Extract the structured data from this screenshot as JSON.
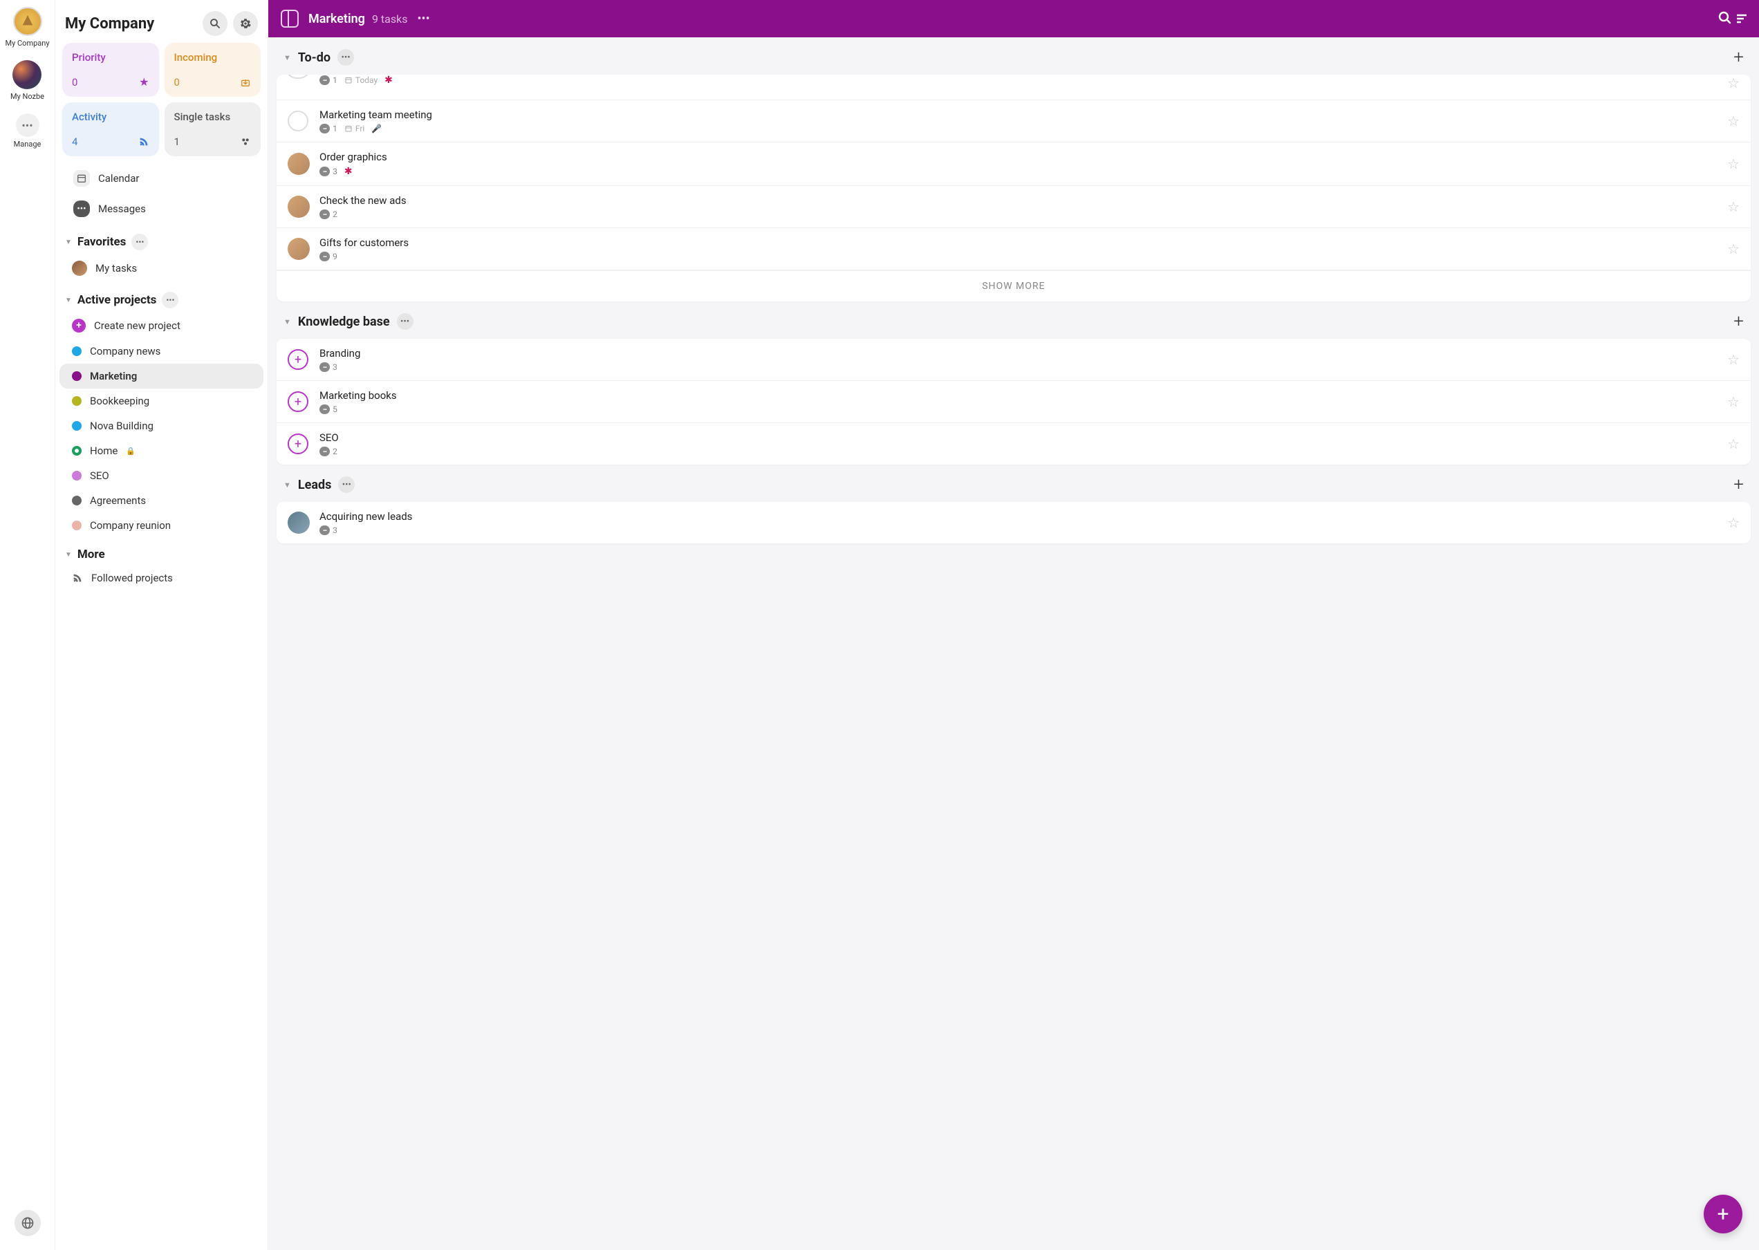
{
  "rail": {
    "company": "My Company",
    "nozbe": "My Nozbe",
    "manage": "Manage"
  },
  "sidebar": {
    "title": "My Company",
    "tiles": {
      "priority": {
        "label": "Priority",
        "count": "0",
        "color": "#a238c4",
        "bg": "#f5ecfa",
        "icon": "★"
      },
      "incoming": {
        "label": "Incoming",
        "count": "0",
        "color": "#d98b1e",
        "bg": "#fcf3e6",
        "icon": "⬇"
      },
      "activity": {
        "label": "Activity",
        "count": "4",
        "color": "#3b7dd8",
        "bg": "#eaf1fb",
        "icon": "rss"
      },
      "single": {
        "label": "Single tasks",
        "count": "1",
        "color": "#555",
        "bg": "#efefef",
        "icon": "⋯"
      }
    },
    "calendar": "Calendar",
    "messages": "Messages",
    "favorites": "Favorites",
    "mytasks": "My tasks",
    "activeprojects": "Active projects",
    "createproject": "Create new project",
    "projects": [
      {
        "name": "Company news",
        "color": "#1fa8e8"
      },
      {
        "name": "Marketing",
        "color": "#8a0f8a",
        "active": true
      },
      {
        "name": "Bookkeeping",
        "color": "#b5b51f"
      },
      {
        "name": "Nova Building",
        "color": "#1fa8e8"
      },
      {
        "name": "Home",
        "color": "#1a9e5c",
        "lock": true,
        "ring": true
      },
      {
        "name": "SEO",
        "color": "#c97dd8"
      },
      {
        "name": "Agreements",
        "color": "#666"
      },
      {
        "name": "Company reunion",
        "color": "#e8b5a8"
      }
    ],
    "more": "More",
    "followed": "Followed projects"
  },
  "header": {
    "title": "Marketing",
    "subtitle": "9 tasks"
  },
  "groups": [
    {
      "title": "To-do",
      "tasks": [
        {
          "title": "",
          "partial": true,
          "comments": "1",
          "date": "Today",
          "dateicon": true,
          "splat": true
        },
        {
          "title": "Marketing team meeting",
          "check": true,
          "comments": "1",
          "date": "Fri",
          "dateicon": true,
          "mic": true
        },
        {
          "title": "Order graphics",
          "avatar": true,
          "comments": "3",
          "splat": true
        },
        {
          "title": "Check the new ads",
          "avatar": true,
          "comments": "2"
        },
        {
          "title": "Gifts for customers",
          "avatar": true,
          "comments": "9"
        }
      ],
      "showmore": "SHOW MORE"
    },
    {
      "title": "Knowledge base",
      "tasks": [
        {
          "title": "Branding",
          "plus": true,
          "comments": "3"
        },
        {
          "title": "Marketing books",
          "plus": true,
          "comments": "5"
        },
        {
          "title": "SEO",
          "plus": true,
          "comments": "2"
        }
      ]
    },
    {
      "title": "Leads",
      "tasks": [
        {
          "title": "Acquiring new leads",
          "avatar": true,
          "avatarAlt": true,
          "comments": "3"
        }
      ]
    }
  ]
}
